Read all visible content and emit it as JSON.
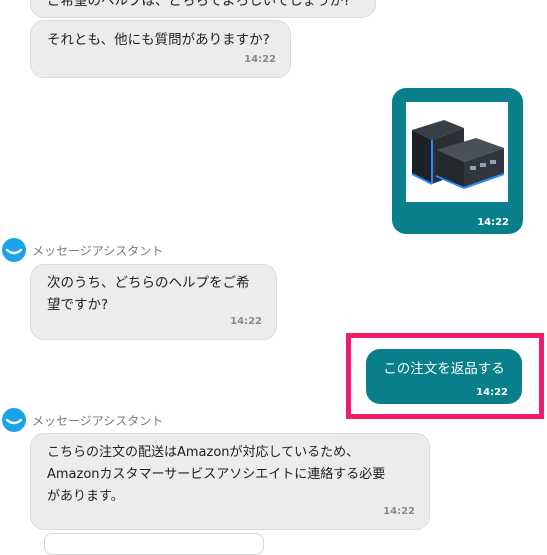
{
  "messages": {
    "top_partial": "ご希望のヘルプは、どちらでよろしいでしょうか?",
    "ask_other": {
      "text": "それとも、他にも質問がありますか?",
      "time": "14:22"
    },
    "user_product": {
      "image_alt": "mini PC product image",
      "time": "14:22"
    },
    "assistant_1": {
      "name": "メッセージアシスタント",
      "lines": [
        "次のうち、どちらのヘルプをご希",
        "望ですか?"
      ],
      "time": "14:22"
    },
    "user_return": {
      "text": "この注文を返品する",
      "time": "14:22"
    },
    "assistant_2": {
      "name": "メッセージアシスタント",
      "lines": [
        "こちらの注文の配送はAmazonが対応しているため、",
        "Amazonカスタマーサービスアソシエイトに連絡する必要",
        "があります。"
      ],
      "time": "14:22"
    }
  },
  "colors": {
    "user_bubble": "#0a7f8c",
    "assistant_bubble": "#ececec",
    "highlight": "#ee1c6a",
    "avatar": "#1aa3e8"
  },
  "icons": [
    "assistant-avatar-icon",
    "product-image"
  ]
}
